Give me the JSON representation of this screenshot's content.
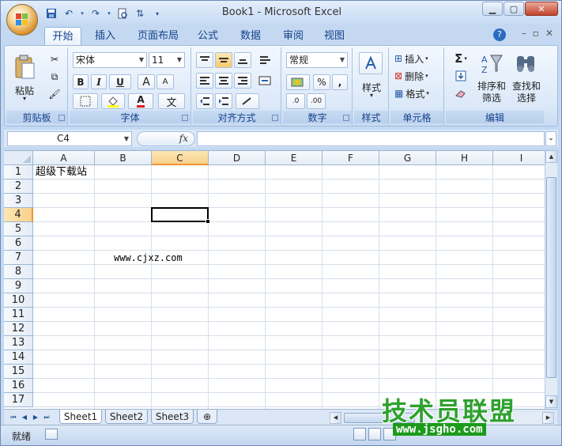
{
  "window": {
    "title": "Book1 - Microsoft Excel"
  },
  "quick_access": {
    "icons": [
      "save-icon",
      "undo-icon",
      "redo-icon",
      "print-preview-icon",
      "sort-icon",
      "customize-icon"
    ]
  },
  "tabs": [
    "开始",
    "插入",
    "页面布局",
    "公式",
    "数据",
    "审阅",
    "视图"
  ],
  "active_tab": "开始",
  "ribbon": {
    "clipboard": {
      "label": "剪贴板",
      "paste": "粘贴"
    },
    "font": {
      "label": "字体",
      "name": "宋体",
      "size": "11",
      "bold": "B",
      "italic": "I",
      "underline": "U",
      "grow": "A",
      "shrink": "A",
      "font_color": "A",
      "phonetic": "文"
    },
    "alignment": {
      "label": "对齐方式"
    },
    "number": {
      "label": "数字",
      "format": "常规",
      "percent": "%",
      "comma": ",",
      "inc_decimal": ".0",
      "dec_decimal": ".00"
    },
    "styles": {
      "label": "样式",
      "button": "样式"
    },
    "cells": {
      "label": "单元格",
      "insert": "插入",
      "delete": "删除",
      "format": "格式"
    },
    "editing": {
      "label": "编辑",
      "sigma": "Σ",
      "sort_filter": [
        "排序和",
        "筛选"
      ],
      "find_select": [
        "查找和",
        "选择"
      ]
    }
  },
  "formula_bar": {
    "name_box": "C4",
    "fx": "fx",
    "formula": ""
  },
  "grid": {
    "columns": [
      "A",
      "B",
      "C",
      "D",
      "E",
      "F",
      "G",
      "H",
      "I"
    ],
    "rows": [
      "1",
      "2",
      "3",
      "4",
      "5",
      "6",
      "7",
      "8",
      "9",
      "10",
      "11",
      "12",
      "13",
      "14",
      "15",
      "16",
      "17"
    ],
    "selected_column": "C",
    "selected_row": "4",
    "cells": {
      "A1": "超级下载站",
      "B7": "www.cjxz.com"
    }
  },
  "sheets": [
    "Sheet1",
    "Sheet2",
    "Sheet3"
  ],
  "active_sheet": "Sheet1",
  "status": {
    "text": "就绪"
  },
  "watermark": {
    "title": "技术员联盟",
    "url": "www.jsgho.com"
  },
  "colors": {
    "accent": "#15428b",
    "selection": "#f8d28b",
    "ribbon": "#dbe8f8"
  }
}
